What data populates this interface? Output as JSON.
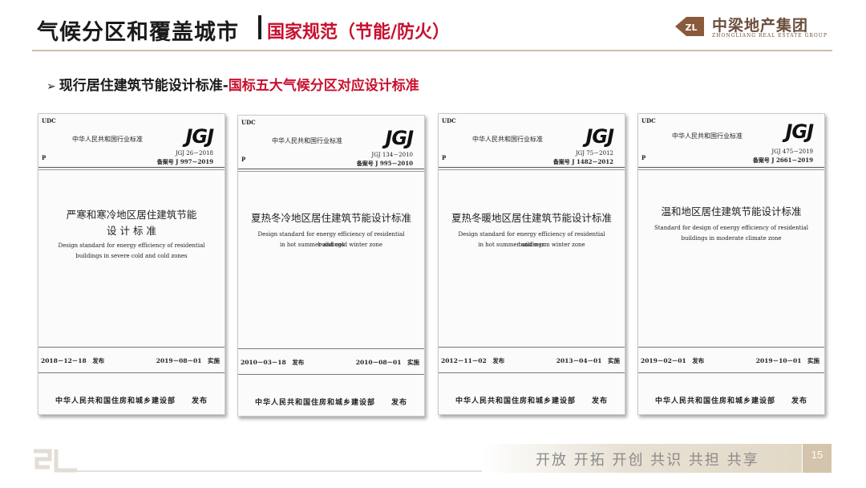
{
  "header": {
    "title": "气候分区和覆盖城市",
    "subtitle": "国家规范（节能/防火）"
  },
  "logo": {
    "cn": "中梁地产集团",
    "en": "ZHONGLIANG REAL ESTATE GROUP",
    "mark": "zl-logo-mark",
    "color": "#6b4e3b"
  },
  "section": {
    "prefix": "现行居住建筑节能设计标准-",
    "highlight": "国标五大气候分区对应设计标准",
    "bullet": "➢"
  },
  "documents": [
    {
      "udc": "UDC",
      "issuer_top": "中华人民共和国行业标准",
      "logo_text": "JGJ",
      "code": "JGJ 26－2018",
      "record": "备案号 J 997－2019",
      "p": "P",
      "name_cn_line1": "严寒和寒冷地区居住建筑节能",
      "name_cn_line2": "设 计 标 准",
      "name_en_line1": "Design standard for energy efficiency of residential",
      "name_en_line2": "buildings in severe cold and cold zones",
      "issue_date": "2018－12－18　发布",
      "impl_date": "2019－08－01　实施",
      "publisher": "中华人民共和国住房和城乡建设部　　发布"
    },
    {
      "udc": "UDC",
      "issuer_top": "中华人民共和国行业标准",
      "logo_text": "JGJ",
      "code": "JGJ 134－2010",
      "record": "备案号 J 995－2010",
      "p": "P",
      "name_cn_line1": "夏热冬冷地区居住建筑节能设计标准",
      "name_cn_line2": "",
      "name_en_line1": "Design standard for energy efficiency of residential buildings",
      "name_en_line2": "in hot summer and cold winter zone",
      "issue_date": "2010－03－18　发布",
      "impl_date": "2010－08－01　实施",
      "publisher": "中华人民共和国住房和城乡建设部　　发布"
    },
    {
      "udc": "UDC",
      "issuer_top": "中华人民共和国行业标准",
      "logo_text": "JGJ",
      "code": "JGJ 75－2012",
      "record": "备案号 J 1482－2012",
      "p": "P",
      "name_cn_line1": "夏热冬暖地区居住建筑节能设计标准",
      "name_cn_line2": "",
      "name_en_line1": "Design standard for energy efficiency of residential buildings",
      "name_en_line2": "in hot summer and warm winter zone",
      "issue_date": "2012－11－02　发布",
      "impl_date": "2013－04－01　实施",
      "publisher": "中华人民共和国住房和城乡建设部　　发布"
    },
    {
      "udc": "UDC",
      "issuer_top": "中华人民共和国行业标准",
      "logo_text": "JGJ",
      "code": "JGJ 475－2019",
      "record": "备案号 J 2661－2019",
      "p": "P",
      "name_cn_line1": "温和地区居住建筑节能设计标准",
      "name_cn_line2": "",
      "name_en_line1": "Standard for design of energy efficiency of residential",
      "name_en_line2": "buildings in moderate climate zone",
      "issue_date": "2019－02－01　发布",
      "impl_date": "2019－10－01　实施",
      "publisher": "中华人民共和国住房和城乡建设部　　发布"
    }
  ],
  "footer": {
    "slogan": "开放 开拓 开创 共识 共担 共享",
    "page_number": "15",
    "mark": "zl-footer-mark"
  },
  "colors": {
    "accent_red": "#c8102e",
    "gold": "#cdbfa8",
    "page_num_bg": "#d3c4ab"
  }
}
